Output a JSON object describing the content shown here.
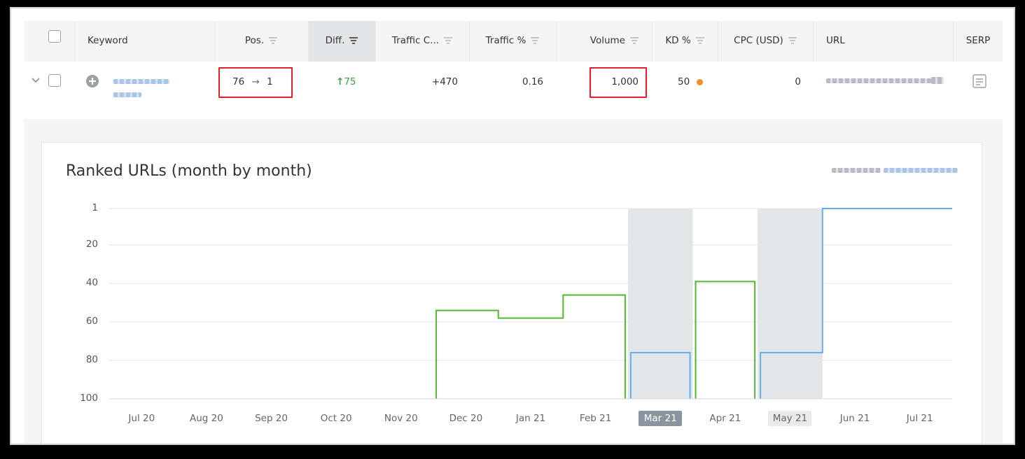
{
  "table": {
    "headers": {
      "keyword": "Keyword",
      "pos": "Pos.",
      "diff": "Diff.",
      "traffic_c": "Traffic C...",
      "traffic_pct": "Traffic %",
      "volume": "Volume",
      "kd": "KD %",
      "cpc": "CPC (USD)",
      "url": "URL",
      "serp": "SERP"
    },
    "row": {
      "pos_from": "76",
      "pos_arrow": "→",
      "pos_to": "1",
      "diff_arrow": "↑",
      "diff_value": "75",
      "traffic_change": "+470",
      "traffic_pct": "0.16",
      "volume": "1,000",
      "kd": "50",
      "cpc": "0"
    }
  },
  "colors": {
    "green_line": "#52b830",
    "blue_line": "#6aaee8",
    "highlight_band": "#e3e6e8",
    "kd_dot": "#f7902b",
    "annotation_red": "#e0202a",
    "diff_green": "#3aa335"
  },
  "chart_data": {
    "type": "line",
    "title": "Ranked URLs (month by month)",
    "xlabel": "",
    "ylabel": "",
    "x": [
      "Jul 20",
      "Aug 20",
      "Sep 20",
      "Oct 20",
      "Nov 20",
      "Dec 20",
      "Jan 21",
      "Feb 21",
      "Mar 21",
      "Apr 21",
      "May 21",
      "Jun 21",
      "Jul 21"
    ],
    "y_ticks": [
      1,
      20,
      40,
      60,
      80,
      100
    ],
    "ylim": [
      1,
      100
    ],
    "y_inverted": true,
    "grid": true,
    "highlighted_x": [
      "Mar 21"
    ],
    "soft_highlighted_x": [
      "May 21"
    ],
    "series": [
      {
        "color": "green",
        "values": [
          null,
          null,
          null,
          null,
          null,
          54,
          58,
          46,
          null,
          39,
          null,
          null,
          null
        ]
      },
      {
        "color": "blue",
        "values": [
          null,
          null,
          null,
          null,
          null,
          null,
          null,
          null,
          76,
          null,
          76,
          1,
          1
        ]
      }
    ]
  }
}
